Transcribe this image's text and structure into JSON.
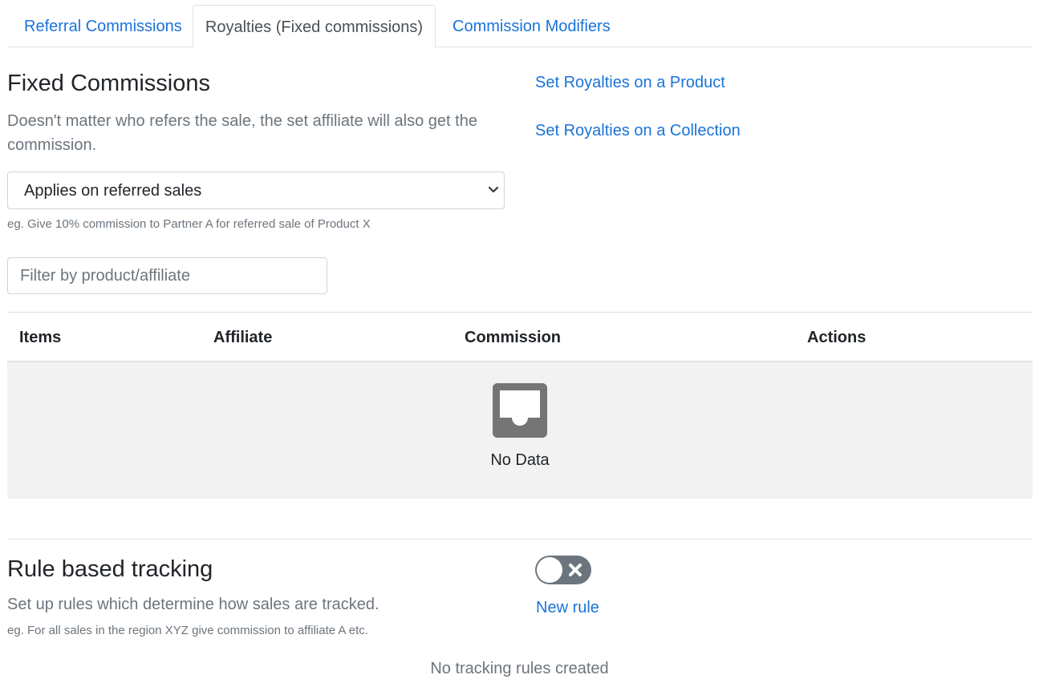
{
  "tabs": [
    {
      "label": "Referral Commissions",
      "active": false
    },
    {
      "label": "Royalties (Fixed commissions)",
      "active": true
    },
    {
      "label": "Commission Modifiers",
      "active": false
    }
  ],
  "fixed": {
    "title": "Fixed Commissions",
    "description": "Doesn't matter who refers the sale, the set affiliate will also get the commission.",
    "links": {
      "product": "Set Royalties on a Product",
      "collection": "Set Royalties on a Collection"
    },
    "select_value": "Applies on referred sales",
    "select_hint": "eg. Give 10% commission to Partner A for referred sale of Product X",
    "filter_placeholder": "Filter by product/affiliate"
  },
  "table": {
    "columns": [
      "Items",
      "Affiliate",
      "Commission",
      "Actions"
    ],
    "rows": [],
    "empty_text": "No Data"
  },
  "rules": {
    "title": "Rule based tracking",
    "description": "Set up rules which determine how sales are tracked.",
    "hint": "eg. For all sales in the region XYZ give commission to affiliate A etc.",
    "toggle_on": false,
    "new_rule_label": "New rule",
    "empty_text": "No tracking rules created"
  },
  "colors": {
    "link": "#1a73d9",
    "muted": "#6c757d",
    "empty_bg": "#f2f2f2",
    "toggle_off": "#6c757d"
  },
  "icons": {
    "select_caret": "chevron-down-icon",
    "empty_state": "inbox-icon",
    "toggle_off": "close-icon"
  }
}
